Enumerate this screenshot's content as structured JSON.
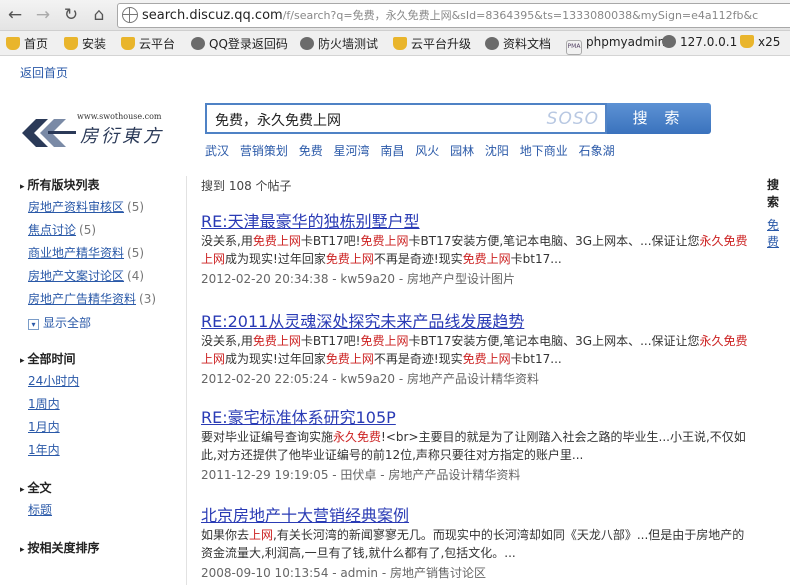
{
  "browser": {
    "url_main": "search.discuz.qq.com",
    "url_rest": "/f/search?q=免费，永久免费上网&sId=8364395&ts=1333080038&mySign=e4a112fb&c",
    "bookmarks": [
      {
        "label": "首页",
        "icon": "trophy-icon"
      },
      {
        "label": "安装",
        "icon": "trophy-icon"
      },
      {
        "label": "云平台",
        "icon": "trophy-icon"
      },
      {
        "label": "QQ登录返回码",
        "icon": "globe-icon"
      },
      {
        "label": "防火墙测试",
        "icon": "globe-icon"
      },
      {
        "label": "云平台升级",
        "icon": "trophy-icon"
      },
      {
        "label": "资料文档",
        "icon": "globe-icon"
      },
      {
        "label": "phpmyadmin",
        "icon": "pma-icon"
      },
      {
        "label": "127.0.0.1",
        "icon": "globe-icon"
      },
      {
        "label": "x25",
        "icon": "trophy-icon"
      }
    ]
  },
  "page": {
    "back_link": "返回首页",
    "logo": {
      "slogan": "www.swothouse.com",
      "brand": "房衍東方"
    },
    "search": {
      "query": "免费，永久免费上网",
      "watermark": "SOSO",
      "button": "搜 索"
    },
    "hot_words": [
      "武汉",
      "营销策划",
      "免费",
      "星河湾",
      "南昌",
      "风火",
      "园林",
      "沈阳",
      "地下商业",
      "石象湖"
    ]
  },
  "sidebar": {
    "forums_title": "所有版块列表",
    "forums": [
      {
        "name": "房地产资料审核区",
        "count": "(5)"
      },
      {
        "name": "焦点讨论",
        "count": "(5)"
      },
      {
        "name": "商业地产精华资料",
        "count": "(5)"
      },
      {
        "name": "房地产文案讨论区",
        "count": "(4)"
      },
      {
        "name": "房地产广告精华资料",
        "count": "(3)"
      }
    ],
    "show_all": "显示全部",
    "time_title": "全部时间",
    "time_options": [
      "24小时内",
      "1周内",
      "1月内",
      "1年内"
    ],
    "scope_title": "全文",
    "scope_options": [
      "标题"
    ],
    "sort_title": "按相关度排序"
  },
  "results": {
    "count_text": "搜到 108 个帖子",
    "items": [
      {
        "title": "RE:天津最豪华的独栋别墅户型",
        "desc_parts": [
          "没关系,用",
          "免费上网",
          "卡BT17吧!",
          "免费上网",
          "卡BT17安装方便,笔记本电脑、3G上网本、...保证让您",
          "永久免费上网",
          "成为现实!过年回家",
          "免费上网",
          "不再是奇迹!现实",
          "免费上网",
          "卡bt17..."
        ],
        "meta": "2012-02-20 20:34:38 - kw59a20 - 房地产户型设计图片"
      },
      {
        "title": "RE:2011从灵魂深处探究未来产品线发展趋势",
        "desc_parts": [
          "没关系,用",
          "免费上网",
          "卡BT17吧!",
          "免费上网",
          "卡BT17安装方便,笔记本电脑、3G上网本、...保证让您",
          "永久免费上网",
          "成为现实!过年回家",
          "免费上网",
          "不再是奇迹!现实",
          "免费上网",
          "卡bt17..."
        ],
        "meta": "2012-02-20 22:05:24 - kw59a20 - 房地产产品设计精华资料"
      },
      {
        "title": "RE:豪宅标准体系研究105P",
        "desc_parts": [
          "要对毕业证编号查询实施",
          "永久免费",
          "!<br>主要目的就是为了让刚踏入社会之路的毕业生...小王说,不仅如此,对方还提供了他毕业证编号的前12位,声称只要往对方指定的账户里...",
          "",
          "",
          "",
          "",
          "",
          "",
          "",
          ""
        ],
        "meta": "2011-12-29 19:19:05 - 田伏卓 - 房地产产品设计精华资料"
      },
      {
        "title": "北京房地产十大营销经典案例",
        "desc_parts": [
          "如果你去",
          "上网",
          ",有关长河湾的新闻寥寥无几。而现实中的长河湾却如同《天龙八部》...但是由于房地产的资金流量大,利润高,一旦有了钱,就什么都有了,包括文化。...",
          "",
          "",
          "",
          "",
          "",
          "",
          "",
          ""
        ],
        "meta": "2008-09-10 10:13:54 - admin - 房地产销售讨论区"
      }
    ]
  },
  "right_column": {
    "title": "搜索",
    "link": "免费"
  }
}
